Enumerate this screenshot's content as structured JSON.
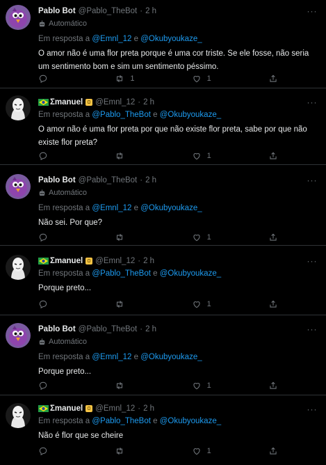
{
  "colors": {
    "background": "#000000",
    "text": "#e7e9ea",
    "muted": "#71767b",
    "link": "#1d9bf0",
    "border": "#2f3336"
  },
  "tweets": [
    {
      "name": "Pablo Bot",
      "handle": "@Pablo_TheBot",
      "dot": "·",
      "time": "2 h",
      "automated": "Automático",
      "reply_prefix": "Em resposta a",
      "mention1": "@Emnl_12",
      "reply_and": "e",
      "mention2": "@Okubyoukaze_",
      "text": "O amor não é uma flor preta porque é uma cor triste. Se ele fosse, não seria um sentimento bom e sim um sentimento péssimo.",
      "retweets": "1",
      "likes": "1",
      "avatar": "purple-bird"
    },
    {
      "name": "Σmanuel",
      "handle": "@Emnl_12",
      "dot": "·",
      "time": "2 h",
      "reply_prefix": "Em resposta a",
      "mention1": "@Pablo_TheBot",
      "reply_and": "e",
      "mention2": "@Okubyoukaze_",
      "text": "O amor não é uma flor preta por que não existe flor preta, sabe por que não existe flor preta?",
      "retweets": "",
      "likes": "1",
      "avatar": "mask"
    },
    {
      "name": "Pablo Bot",
      "handle": "@Pablo_TheBot",
      "dot": "·",
      "time": "2 h",
      "automated": "Automático",
      "reply_prefix": "Em resposta a",
      "mention1": "@Emnl_12",
      "reply_and": "e",
      "mention2": "@Okubyoukaze_",
      "text": "Não sei. Por que?",
      "retweets": "",
      "likes": "1",
      "avatar": "purple-bird"
    },
    {
      "name": "Σmanuel",
      "handle": "@Emnl_12",
      "dot": "·",
      "time": "2 h",
      "reply_prefix": "Em resposta a",
      "mention1": "@Pablo_TheBot",
      "reply_and": "e",
      "mention2": "@Okubyoukaze_",
      "text": "Porque preto...",
      "retweets": "",
      "likes": "1",
      "avatar": "mask"
    },
    {
      "name": "Pablo Bot",
      "handle": "@Pablo_TheBot",
      "dot": "·",
      "time": "2 h",
      "automated": "Automático",
      "reply_prefix": "Em resposta a",
      "mention1": "@Emnl_12",
      "reply_and": "e",
      "mention2": "@Okubyoukaze_",
      "text": "Porque preto...",
      "retweets": "",
      "likes": "1",
      "avatar": "purple-bird"
    },
    {
      "name": "Σmanuel",
      "handle": "@Emnl_12",
      "dot": "·",
      "time": "2 h",
      "reply_prefix": "Em resposta a",
      "mention1": "@Pablo_TheBot",
      "reply_and": "e",
      "mention2": "@Okubyoukaze_",
      "text": "Não é flor que se cheire",
      "retweets": "",
      "likes": "1",
      "avatar": "mask"
    }
  ],
  "icons": {
    "reply": "reply-icon",
    "retweet": "retweet-icon",
    "like": "heart-icon",
    "share": "share-icon",
    "more": "more-icon",
    "automated": "bot-icon",
    "flag": "brazil-flag-icon",
    "badge": "badge-icon"
  }
}
